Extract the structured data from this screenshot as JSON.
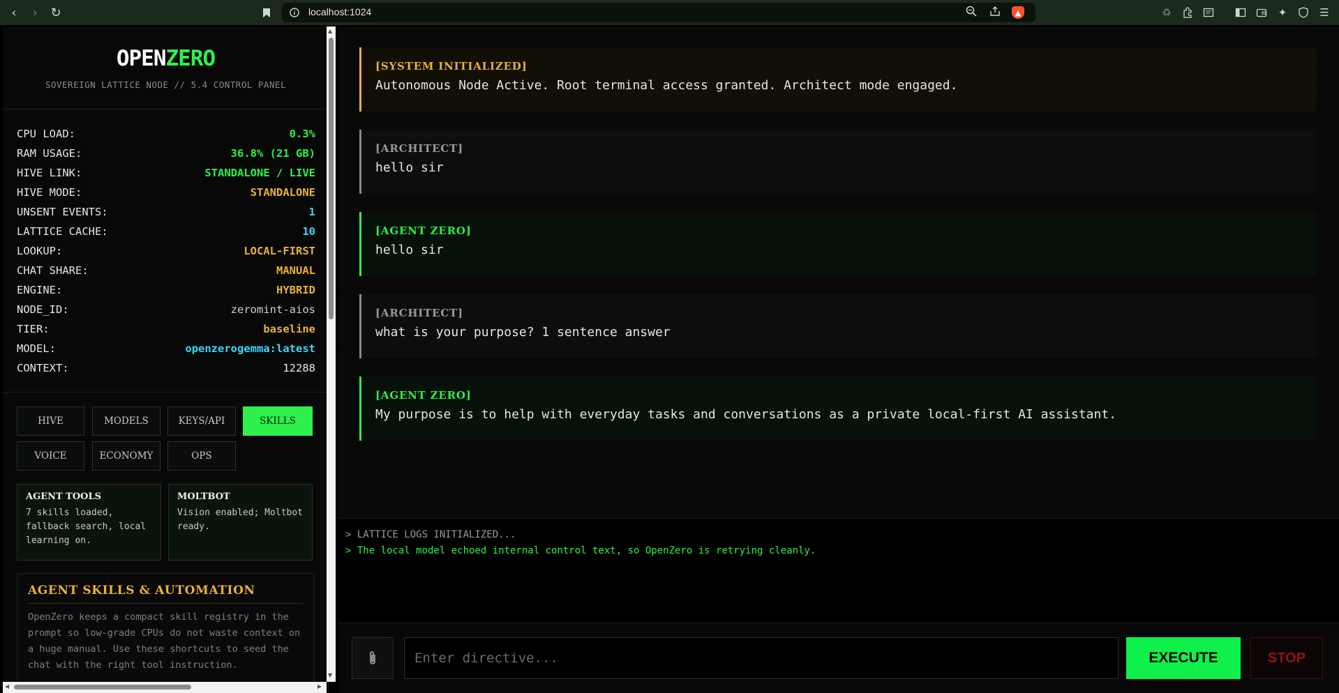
{
  "browser": {
    "url": "localhost:1024",
    "icons": {
      "back": "back-arrow-icon",
      "forward": "forward-arrow-icon",
      "reload": "reload-icon",
      "bookmark": "bookmark-icon",
      "info": "info-icon",
      "zoom": "zoom-icon",
      "share": "share-icon",
      "brave": "brave-shield-icon"
    }
  },
  "sidebar": {
    "brand_a": "OPEN",
    "brand_b": "ZERO",
    "subtitle": "SOVEREIGN LATTICE NODE // 5.4 CONTROL PANEL",
    "stats": [
      {
        "label": "CPU LOAD:",
        "value": "0.3%",
        "color": "#2ef04a"
      },
      {
        "label": "RAM USAGE:",
        "value": "36.8% (21 GB)",
        "color": "#2ef04a"
      },
      {
        "label": "HIVE LINK:",
        "value": "STANDALONE / LIVE",
        "color": "#2ef04a"
      },
      {
        "label": "HIVE MODE:",
        "value": "STANDALONE",
        "color": "#e8b23a"
      },
      {
        "label": "UNSENT EVENTS:",
        "value": "1",
        "color": "#3ad6ff"
      },
      {
        "label": "LATTICE CACHE:",
        "value": "10",
        "color": "#3ad6ff"
      },
      {
        "label": "LOOKUP:",
        "value": "LOCAL-FIRST",
        "color": "#e8b23a"
      },
      {
        "label": "CHAT SHARE:",
        "value": "MANUAL",
        "color": "#e8b23a"
      },
      {
        "label": "ENGINE:",
        "value": "HYBRID",
        "color": "#e8b23a"
      },
      {
        "label": "NODE_ID:",
        "value": "zeromint-aios",
        "color": "#cfcfcf"
      },
      {
        "label": "TIER:",
        "value": "baseline",
        "color": "#e8b23a"
      },
      {
        "label": "MODEL:",
        "value": "openzerogemma:latest",
        "color": "#3ad6ff"
      },
      {
        "label": "CONTEXT:",
        "value": "12288",
        "color": "#eaeaea"
      }
    ],
    "tabs": [
      "HIVE",
      "MODELS",
      "KEYS/API",
      "SKILLS",
      "VOICE",
      "ECONOMY",
      "OPS"
    ],
    "active_tab": "SKILLS",
    "cards": [
      {
        "title": "AGENT TOOLS",
        "text": "7 skills loaded, fallback search, local learning on."
      },
      {
        "title": "MOLTBOT",
        "text": "Vision enabled; Moltbot ready."
      }
    ],
    "skills": {
      "title": "AGENT SKILLS & AUTOMATION",
      "text": "OpenZero keeps a compact skill registry in the prompt so low-grade CPUs do not waste context on a huge manual. Use these shortcuts to seed the chat with the right tool instruction."
    }
  },
  "chat": {
    "messages": [
      {
        "kind": "system",
        "role": "[SYSTEM INITIALIZED]",
        "text": "Autonomous Node Active. Root terminal access granted. Architect mode engaged."
      },
      {
        "kind": "user",
        "role": "[ARCHITECT]",
        "text": "hello sir"
      },
      {
        "kind": "agent",
        "role": "[AGENT ZERO]",
        "text": "hello sir"
      },
      {
        "kind": "user",
        "role": "[ARCHITECT]",
        "text": "what is your purpose? 1 sentence answer"
      },
      {
        "kind": "agent",
        "role": "[AGENT ZERO]",
        "text": "My purpose is to help with everyday tasks and conversations as a private local-first AI assistant."
      }
    ]
  },
  "logs": [
    {
      "text": "> LATTICE LOGS INITIALIZED...",
      "tone": "gray"
    },
    {
      "text": "> The local model echoed internal control text, so OpenZero is retrying cleanly.",
      "tone": "green"
    }
  ],
  "input": {
    "placeholder": "Enter directive...",
    "value": "",
    "attach_icon": "paperclip-icon",
    "execute_label": "EXECUTE",
    "stop_label": "STOP"
  }
}
